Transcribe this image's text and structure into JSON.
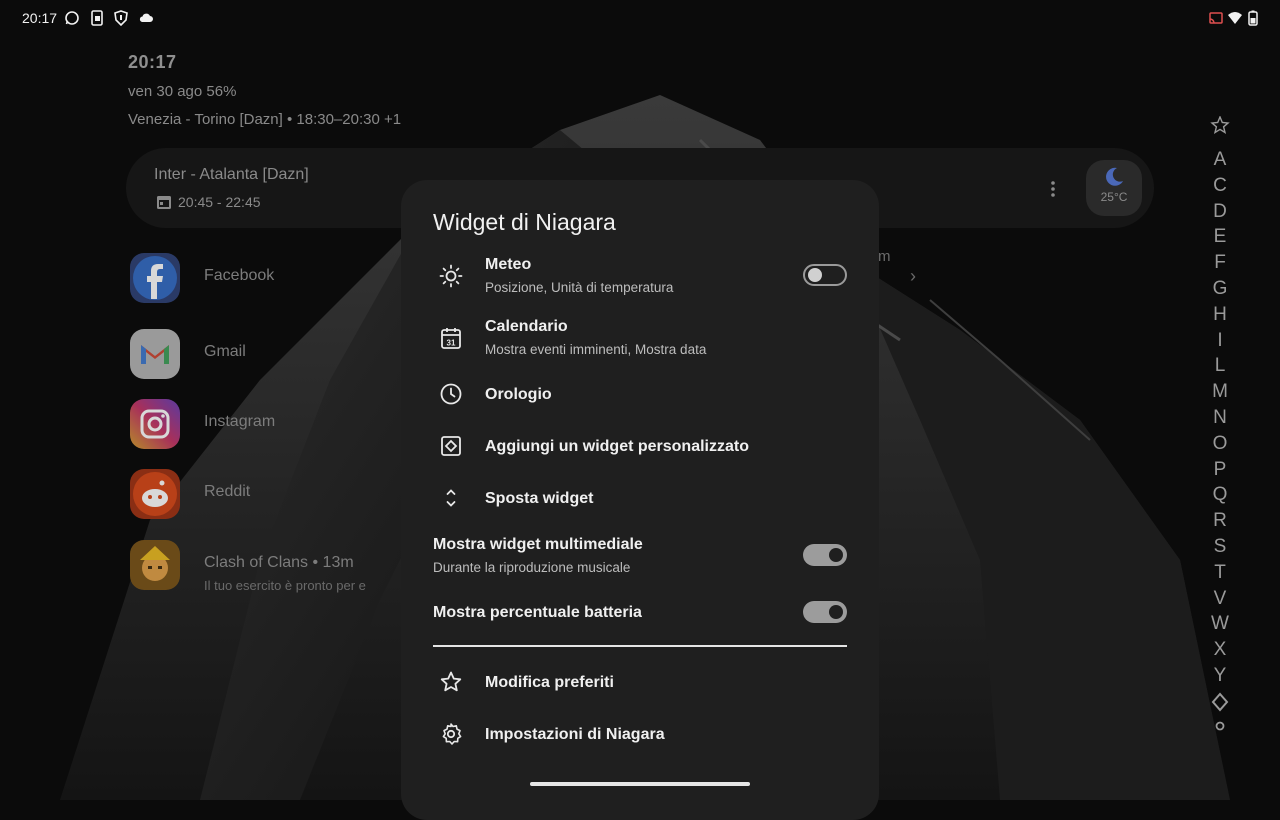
{
  "status_bar": {
    "time": "20:17",
    "left_icons": [
      "whatsapp-icon",
      "phone-screen-icon",
      "shield-icon",
      "cloud-icon"
    ],
    "right_icons": [
      "cast-icon",
      "wifi-icon",
      "battery-icon"
    ]
  },
  "home": {
    "clock": "20:17",
    "date_battery": "ven 30 ago  56%",
    "next_event": "Venezia - Torino [Dazn] • 18:30–20:30 +1",
    "event_card": {
      "title": "Inter - Atalanta [Dazn]",
      "time": "20:45 - 22:45",
      "weather_temp": "25°C"
    },
    "apps": [
      {
        "label": "Facebook",
        "icon": "facebook-icon"
      },
      {
        "label": "Gmail",
        "icon": "gmail-icon"
      },
      {
        "label": "Instagram",
        "icon": "instagram-icon"
      },
      {
        "label": "Reddit",
        "icon": "reddit-icon"
      },
      {
        "label": "Clash of Clans • 13m",
        "sub": "Il tuo esercito è pronto per e",
        "icon": "clash-of-clans-icon"
      }
    ],
    "partial_text": "m",
    "alphabet": [
      "A",
      "C",
      "D",
      "E",
      "F",
      "G",
      "H",
      "I",
      "L",
      "M",
      "N",
      "O",
      "P",
      "Q",
      "R",
      "S",
      "T",
      "V",
      "W",
      "X",
      "Y"
    ]
  },
  "sheet": {
    "title": "Widget di Niagara",
    "items": [
      {
        "title": "Meteo",
        "subtitle": "Posizione, Unità di temperatura",
        "icon": "sun-icon",
        "toggle": "off"
      },
      {
        "title": "Calendario",
        "subtitle": "Mostra eventi imminenti, Mostra data",
        "icon": "calendar-icon"
      },
      {
        "title": "Orologio",
        "icon": "clock-icon"
      },
      {
        "title": "Aggiungi un widget personalizzato",
        "icon": "add-widget-icon"
      },
      {
        "title": "Sposta widget",
        "icon": "move-vertical-icon"
      }
    ],
    "media": {
      "title": "Mostra widget multimediale",
      "subtitle": "Durante la riproduzione musicale",
      "toggle": "on"
    },
    "battery": {
      "title": "Mostra percentuale batteria",
      "toggle": "on"
    },
    "favorites": {
      "title": "Modifica preferiti",
      "icon": "star-icon"
    },
    "settings": {
      "title": "Impostazioni di Niagara",
      "icon": "settings-gear-icon"
    }
  },
  "colors": {
    "sheet_bg": "#1f1f1f",
    "text_primary": "#f0f0f0",
    "text_secondary": "#bdbdbd",
    "toggle_on": "#9c9c9c"
  }
}
